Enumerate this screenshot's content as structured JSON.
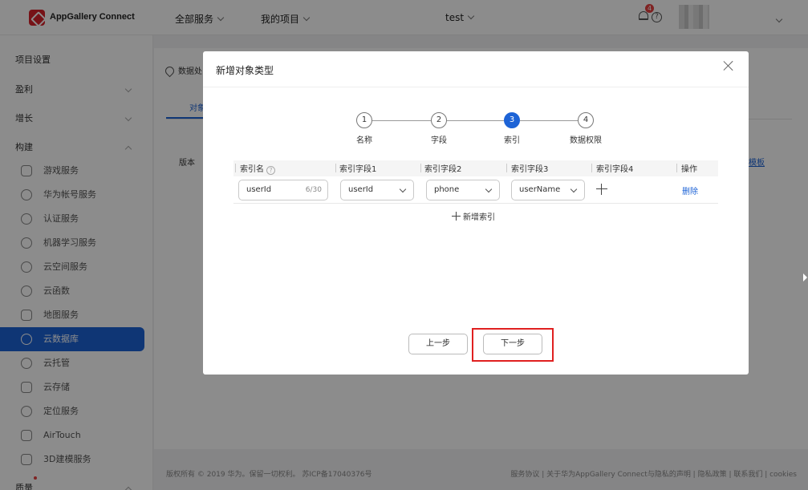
{
  "topbar": {
    "brand": "AppGallery Connect",
    "all_services": "全部服务",
    "my_projects": "我的项目",
    "project": "test",
    "notifications": "4",
    "help": "?"
  },
  "sidebar": {
    "items": [
      {
        "label": "项目设置"
      },
      {
        "label": "盈利"
      },
      {
        "label": "增长"
      },
      {
        "label": "构建"
      },
      {
        "label": "游戏服务"
      },
      {
        "label": "华为帐号服务"
      },
      {
        "label": "认证服务"
      },
      {
        "label": "机器学习服务"
      },
      {
        "label": "云空间服务"
      },
      {
        "label": "云函数"
      },
      {
        "label": "地图服务"
      },
      {
        "label": "云数据库"
      },
      {
        "label": "云托管"
      },
      {
        "label": "云存储"
      },
      {
        "label": "定位服务"
      },
      {
        "label": "AirTouch"
      },
      {
        "label": "3D建模服务"
      },
      {
        "label": "质量"
      }
    ]
  },
  "background": {
    "location": "数据处",
    "tab": "对象",
    "version": "版本",
    "link": "模板",
    "footer_left": "版权所有 © 2019 华为。保留一切权利。 苏ICP备17040376号",
    "footer_right": "服务协议 | 关于华为AppGallery Connect与隐私的声明 | 隐私政策 | 联系我们 | cookies"
  },
  "modal": {
    "title": "新增对象类型",
    "steps": [
      {
        "num": "1",
        "label": "名称"
      },
      {
        "num": "2",
        "label": "字段"
      },
      {
        "num": "3",
        "label": "索引"
      },
      {
        "num": "4",
        "label": "数据权限"
      }
    ],
    "active_step": 3,
    "table": {
      "headers": [
        "索引名",
        "索引字段1",
        "索引字段2",
        "索引字段3",
        "索引字段4",
        "操作"
      ],
      "row": {
        "index_name": "userId",
        "counter": "6/30",
        "field1": "userId",
        "field2": "phone",
        "field3": "userName",
        "action": "删除"
      }
    },
    "add_index": "新增索引",
    "prev_button": "上一步",
    "next_button": "下一步"
  },
  "colors": {
    "accent": "#1d63d6",
    "highlight": "#e02020",
    "badge": "#e84040"
  }
}
